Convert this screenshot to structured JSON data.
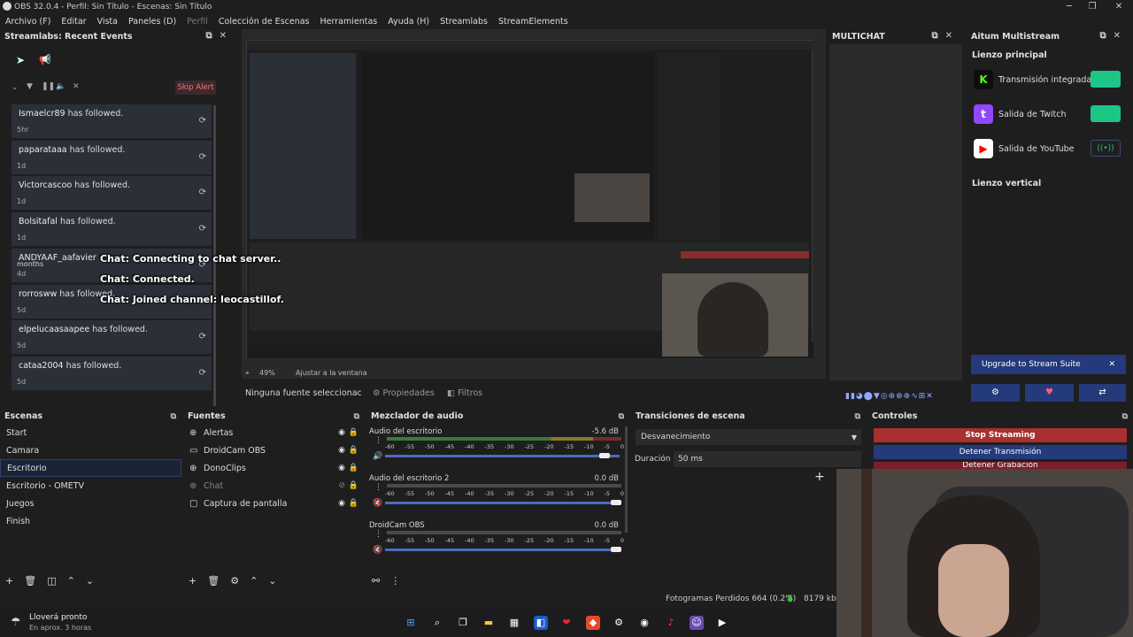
{
  "window": {
    "title": "OBS 32.0.4 - Perfil: Sin Título - Escenas: Sin Título"
  },
  "menu": [
    "Archivo (F)",
    "Editar",
    "Vista",
    "Paneles (D)",
    "Perfil",
    "Colección de Escenas",
    "Herramientas",
    "Ayuda (H)",
    "Streamlabs",
    "StreamElements"
  ],
  "recent_events": {
    "title": "Streamlabs: Recent Events",
    "skip_alert": "Skip Alert",
    "events": [
      {
        "user": "Ismaelcr89",
        "text": "has followed.",
        "time": "5hr"
      },
      {
        "user": "paparataaa",
        "text": "has followed.",
        "time": "1d"
      },
      {
        "user": "Victorcascoo",
        "text": "has followed.",
        "time": "1d"
      },
      {
        "user": "Bolsitafal",
        "text": "has followed.",
        "time": "1d"
      },
      {
        "user": "ANDYAAF_aafavier",
        "text": "",
        "extra": "months",
        "time": "4d"
      },
      {
        "user": "rorrosww",
        "text": "has followed.",
        "time": "5d"
      },
      {
        "user": "elpelucaasaapee",
        "text": "has followed.",
        "time": "5d"
      },
      {
        "user": "cataa2004",
        "text": "has followed.",
        "time": "5d"
      }
    ]
  },
  "chat_overlay": [
    "Chat: Connecting to chat server..",
    "Chat: Connected.",
    "Chat: Joined channel: leocastillof."
  ],
  "preview_bar": {
    "zoom": "49%",
    "fit": "Ajustar a la ventana",
    "no_source": "Ninguna fuente seleccionac",
    "properties": "Propiedades",
    "filters": "Filtros"
  },
  "multichat": {
    "title": "MULTICHAT"
  },
  "aitum": {
    "title": "Aitum Multistream",
    "main_canvas": "Lienzo principal",
    "outputs": [
      {
        "label": "Transmisión integrada",
        "logo": "K",
        "color": "#0d0d0d",
        "logo_color": "#53fc18",
        "active": true
      },
      {
        "label": "Salida de Twitch",
        "logo": "t",
        "color": "#9146ff",
        "logo_color": "#ffffff",
        "active": true
      },
      {
        "label": "Salida de YouTube",
        "logo": "▶",
        "color": "#ffffff",
        "logo_color": "#ff0000",
        "active": false
      }
    ],
    "vertical_canvas": "Lienzo vertical",
    "upgrade": "Upgrade to Stream Suite"
  },
  "scenes": {
    "title": "Escenas",
    "items": [
      "Start",
      "Camara",
      "Escritorio",
      "Escritorio - OMETV",
      "Juegos",
      "Finish"
    ],
    "selected": 2
  },
  "sources": {
    "title": "Fuentes",
    "items": [
      {
        "label": "Alertas",
        "icon": "globe-icon",
        "visible": true
      },
      {
        "label": "DroidCam OBS",
        "icon": "camera-icon",
        "visible": true
      },
      {
        "label": "DonoClips",
        "icon": "globe-icon",
        "visible": true
      },
      {
        "label": "Chat",
        "icon": "globe-icon",
        "visible": false
      },
      {
        "label": "Captura de pantalla",
        "icon": "monitor-icon",
        "visible": true
      }
    ]
  },
  "mixer": {
    "title": "Mezclador de audio",
    "channels": [
      {
        "name": "Audio del escritorio",
        "db": "-5.6 dB",
        "level": 0.95
      },
      {
        "name": "Audio del escritorio 2",
        "db": "0.0 dB",
        "level": 1.0
      },
      {
        "name": "DroidCam OBS",
        "db": "0.0 dB",
        "level": 1.0
      }
    ],
    "scale": [
      "-60",
      "-55",
      "-50",
      "-45",
      "-40",
      "-35",
      "-30",
      "-25",
      "-20",
      "-15",
      "-10",
      "-5",
      "0"
    ]
  },
  "transitions": {
    "title": "Transiciones de escena",
    "selected": "Desvanecimiento",
    "duration_label": "Duración",
    "duration": "50 ms"
  },
  "controls": {
    "title": "Controles",
    "stop_streaming": "Stop Streaming",
    "stop_transmission": "Detener Transmisión",
    "stop_recording": "Detener Grabación"
  },
  "status": {
    "dropped": "Fotogramas Perdidos 664 (0.2%)",
    "bitrate": "8179 kbps"
  },
  "weather": {
    "title": "Lloverá pronto",
    "sub": "En aprox. 3 horas"
  }
}
